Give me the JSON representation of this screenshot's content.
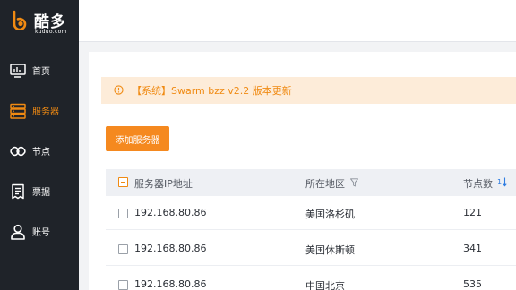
{
  "brand": {
    "name_cn": "酷多",
    "name_en": "kuduo.com",
    "accent": "#f08a12"
  },
  "nav": [
    {
      "label": "首页",
      "icon": "dashboard-icon",
      "active": false
    },
    {
      "label": "服务器",
      "icon": "server-icon",
      "active": true
    },
    {
      "label": "节点",
      "icon": "node-link-icon",
      "active": false
    },
    {
      "label": "票据",
      "icon": "ticket-icon",
      "active": false
    },
    {
      "label": "账号",
      "icon": "user-icon",
      "active": false
    }
  ],
  "notice": {
    "text": "【系统】Swarm bzz v2.2 版本更新",
    "icon": "info-circle-icon"
  },
  "toolbar": {
    "add_label": "添加服务器"
  },
  "table": {
    "columns": [
      "服务器IP地址",
      "所在地区",
      "节点数"
    ],
    "rows": [
      {
        "ip": "192.168.80.86",
        "region": "美国洛杉矶",
        "nodes": "121"
      },
      {
        "ip": "192.168.80.86",
        "region": "美国休斯顿",
        "nodes": "341"
      },
      {
        "ip": "192.168.80.86",
        "region": "中国北京",
        "nodes": "535"
      }
    ]
  }
}
